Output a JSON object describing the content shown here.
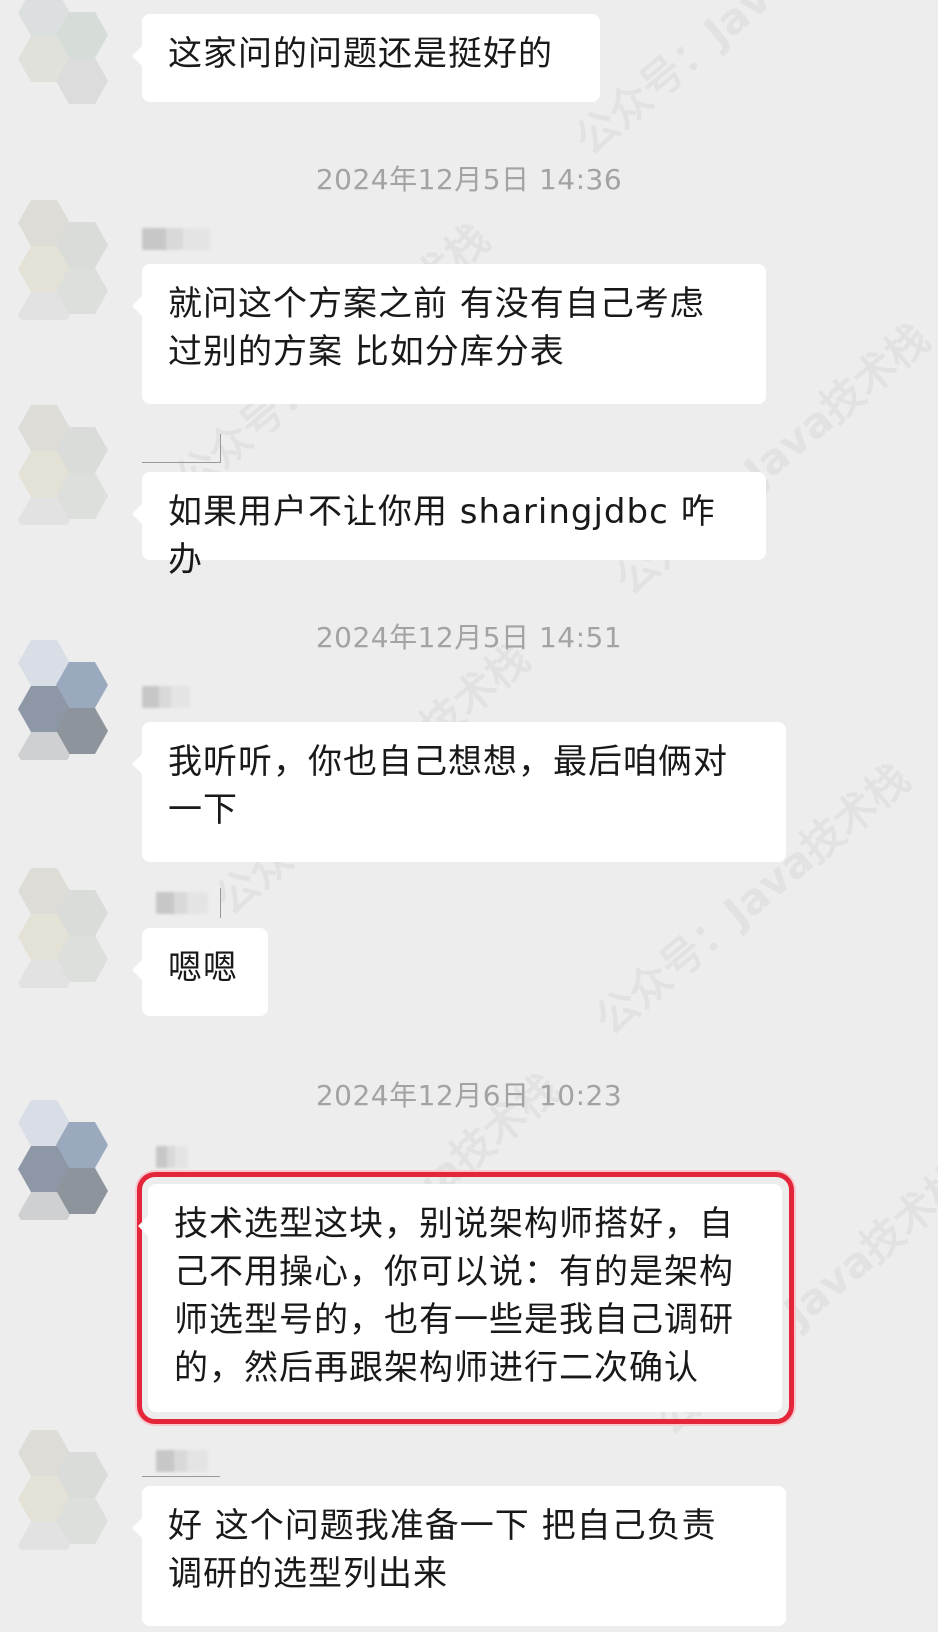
{
  "timestamps": [
    "2024年12月5日 14:36",
    "2024年12月5日 14:51",
    "2024年12月6日 10:23"
  ],
  "messages": [
    "这家问的问题还是挺好的",
    "就问这个方案之前 有没有自己考虑\n过别的方案 比如分库分表",
    "如果用户不让你用 sharingjdbc 咋办",
    "我听听，你也自己想想，最后咱俩对\n一下",
    "嗯嗯",
    "技术选型这块，别说架构师搭好，自\n己不用操心，你可以说：有的是架构\n师选型号的，也有一些是我自己调研\n的，然后再跟架构师进行二次确认",
    "好 这个问题我准备一下 把自己负责\n调研的选型列出来"
  ],
  "watermark": "公众号：Java技术栈",
  "colors": {
    "background": "#ededed",
    "bubble": "#ffffff",
    "text": "#191919",
    "timestamp": "#a3a3a3",
    "highlight": "#e3263a"
  }
}
